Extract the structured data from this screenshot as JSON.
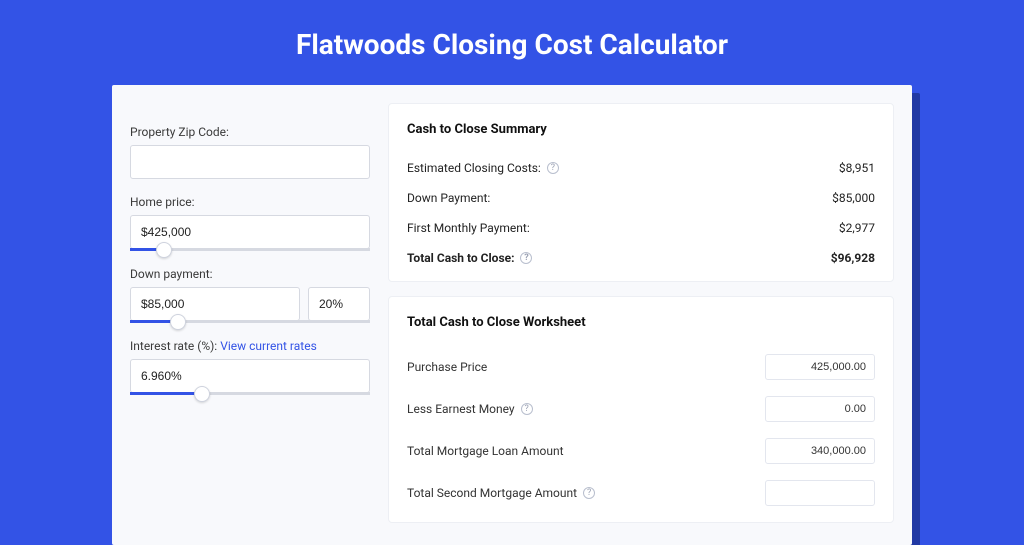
{
  "title": "Flatwoods Closing Cost Calculator",
  "left": {
    "zip_label": "Property Zip Code:",
    "zip_value": "",
    "home_price_label": "Home price:",
    "home_price_value": "$425,000",
    "home_price_slider_pct": 14,
    "down_label": "Down payment:",
    "down_value": "$85,000",
    "down_pct": "20%",
    "down_slider_pct": 20,
    "rate_label_prefix": "Interest rate (%): ",
    "rate_link": "View current rates",
    "rate_value": "6.960%",
    "rate_slider_pct": 30
  },
  "summary": {
    "title": "Cash to Close Summary",
    "rows": [
      {
        "label": "Estimated Closing Costs:",
        "help": true,
        "value": "$8,951"
      },
      {
        "label": "Down Payment:",
        "help": false,
        "value": "$85,000"
      },
      {
        "label": "First Monthly Payment:",
        "help": false,
        "value": "$2,977"
      }
    ],
    "total_label": "Total Cash to Close:",
    "total_value": "$96,928"
  },
  "worksheet": {
    "title": "Total Cash to Close Worksheet",
    "rows": [
      {
        "label": "Purchase Price",
        "help": false,
        "value": "425,000.00"
      },
      {
        "label": "Less Earnest Money",
        "help": true,
        "value": "0.00"
      },
      {
        "label": "Total Mortgage Loan Amount",
        "help": false,
        "value": "340,000.00"
      },
      {
        "label": "Total Second Mortgage Amount",
        "help": true,
        "value": ""
      }
    ]
  },
  "glyph": {
    "help": "?"
  }
}
